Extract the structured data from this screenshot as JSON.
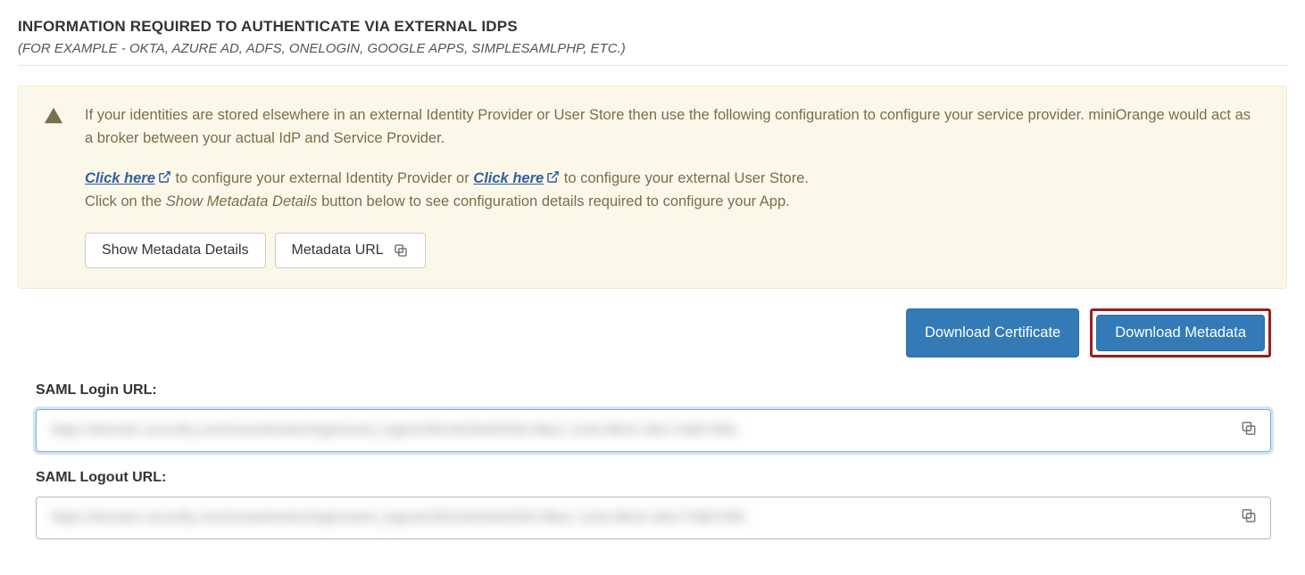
{
  "header": {
    "title": "INFORMATION REQUIRED TO AUTHENTICATE VIA EXTERNAL IDPS",
    "subtitle": "(FOR EXAMPLE - OKTA, AZURE AD, ADFS, ONELOGIN, GOOGLE APPS, SIMPLESAMLPHP, ETC.)"
  },
  "alert": {
    "line1": "If your identities are stored elsewhere in an external Identity Provider or User Store then use the following configuration to configure your service provider. miniOrange would act as a broker between your actual IdP and Service Provider.",
    "click_here_1": "Click here",
    "mid1": " to configure your external Identity Provider or ",
    "click_here_2": "Click here",
    "mid2": " to configure your external User Store.",
    "line3_a": "Click on the ",
    "line3_em": "Show Metadata Details",
    "line3_b": " button below to see configuration details required to configure your App.",
    "btn_show": "Show Metadata Details",
    "btn_meta_url": "Metadata URL"
  },
  "downloads": {
    "cert": "Download Certificate",
    "metadata": "Download Metadata"
  },
  "fields": {
    "login_label": "SAML Login URL:",
    "login_value": "https://domain.xecurify.com/moas/broker/login/saml_login/23014d19e92354-8ba1-11eb-89c9-18e174db745b",
    "logout_label": "SAML Logout URL:",
    "logout_value": "https://domain.xecurify.com/moas/broker/login/saml_logout/23014d19e92354-8ba1-11eb-89c9-18e174db745b"
  }
}
